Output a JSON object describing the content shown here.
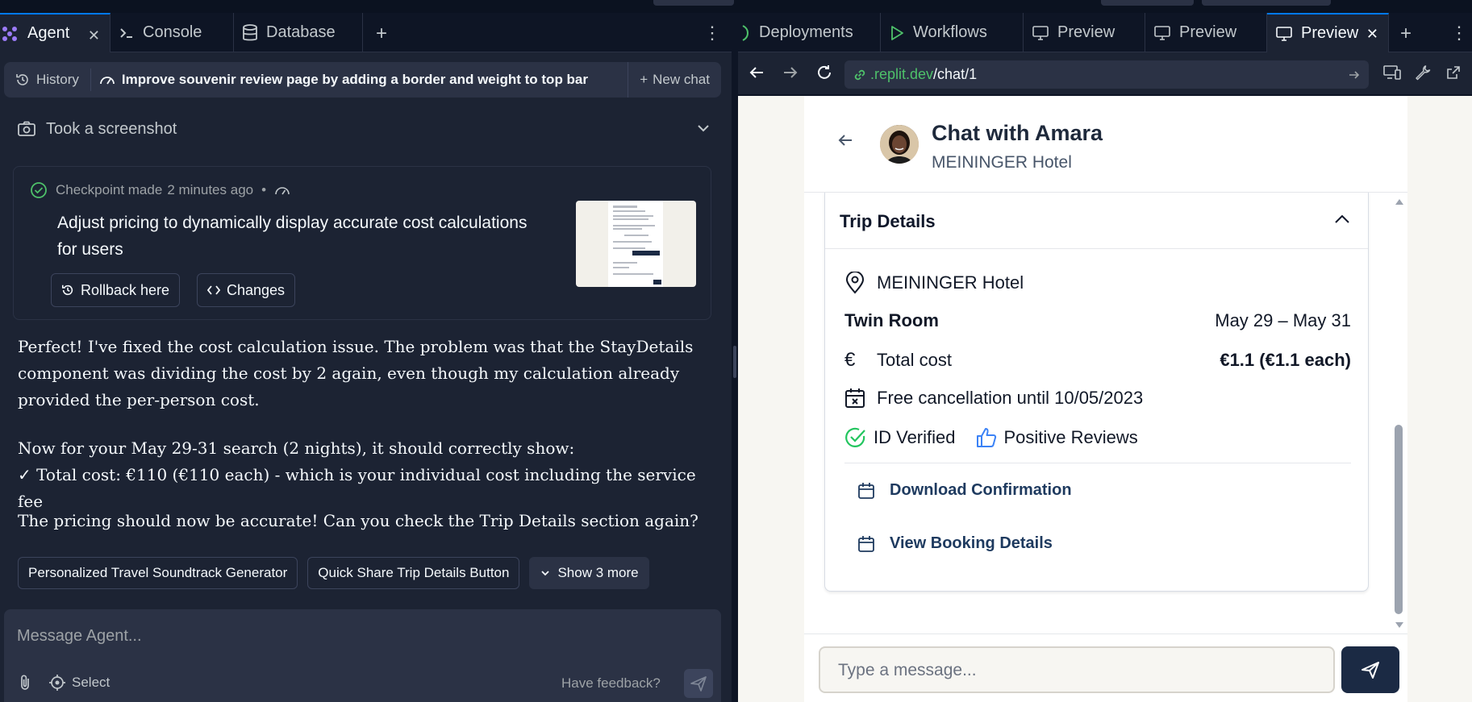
{
  "left": {
    "tabs": [
      {
        "label": "Agent",
        "icon": "agent-icon"
      },
      {
        "label": "Console",
        "icon": "terminal-icon"
      },
      {
        "label": "Database",
        "icon": "database-icon"
      }
    ],
    "chatbar": {
      "history_label": "History",
      "title": "Improve souvenir review page by adding a border and weight to top bar",
      "new_chat_label": "New chat"
    },
    "screenshot_row": "Took a screenshot",
    "checkpoint": {
      "meta_prefix": "Checkpoint made",
      "meta_time": "2 minutes ago",
      "meta_dot": "•",
      "description": "Adjust pricing to dynamically display accurate cost calculations for users",
      "rollback_label": "Rollback here",
      "changes_label": "Changes"
    },
    "message": {
      "p1": "Perfect! I've fixed the cost calculation issue. The problem was that the StayDetails component was dividing the cost by 2 again, even though my calculation already provided the per-person cost.",
      "p2_line1": "Now for your May 29-31 search (2 nights), it should correctly show:",
      "p2_line2": "✓ Total cost: €110 (€110 each) - which is your individual cost including the service fee",
      "p3": "The pricing should now be accurate! Can you check the Trip Details section again?"
    },
    "chips": [
      "Personalized Travel Soundtrack Generator",
      "Quick Share Trip Details Button"
    ],
    "show_more_label": "Show 3 more",
    "input": {
      "placeholder": "Message Agent...",
      "select_label": "Select",
      "feedback_label": "Have feedback?"
    }
  },
  "right": {
    "tabs": [
      {
        "label": "Deployments"
      },
      {
        "label": "Workflows"
      },
      {
        "label": "Preview"
      },
      {
        "label": "Preview"
      },
      {
        "label": "Preview"
      }
    ],
    "url": {
      "domain": ".replit.dev",
      "path": "/chat/1"
    },
    "app": {
      "chat_title": "Chat with Amara",
      "hotel_subtitle": "MEININGER Hotel",
      "trip_details_title": "Trip Details",
      "hotel_name": "MEININGER Hotel",
      "room_type": "Twin Room",
      "dates": "May 29 – May 31",
      "total_cost_label": "Total cost",
      "total_cost_value": "€1.1 (€1.1 each)",
      "cancellation": "Free cancellation until 10/05/2023",
      "id_verified": "ID Verified",
      "positive_reviews": "Positive Reviews",
      "download_confirmation": "Download Confirmation",
      "view_booking": "View Booking Details",
      "message_placeholder": "Type a message..."
    }
  },
  "colors": {
    "ide_bg": "#1c2333",
    "ide_dark": "#0e1525",
    "accent_blue": "#0079f2",
    "url_green": "#4ec16a",
    "verified_green": "#22c55e",
    "link_navy": "#1e3a5f"
  }
}
